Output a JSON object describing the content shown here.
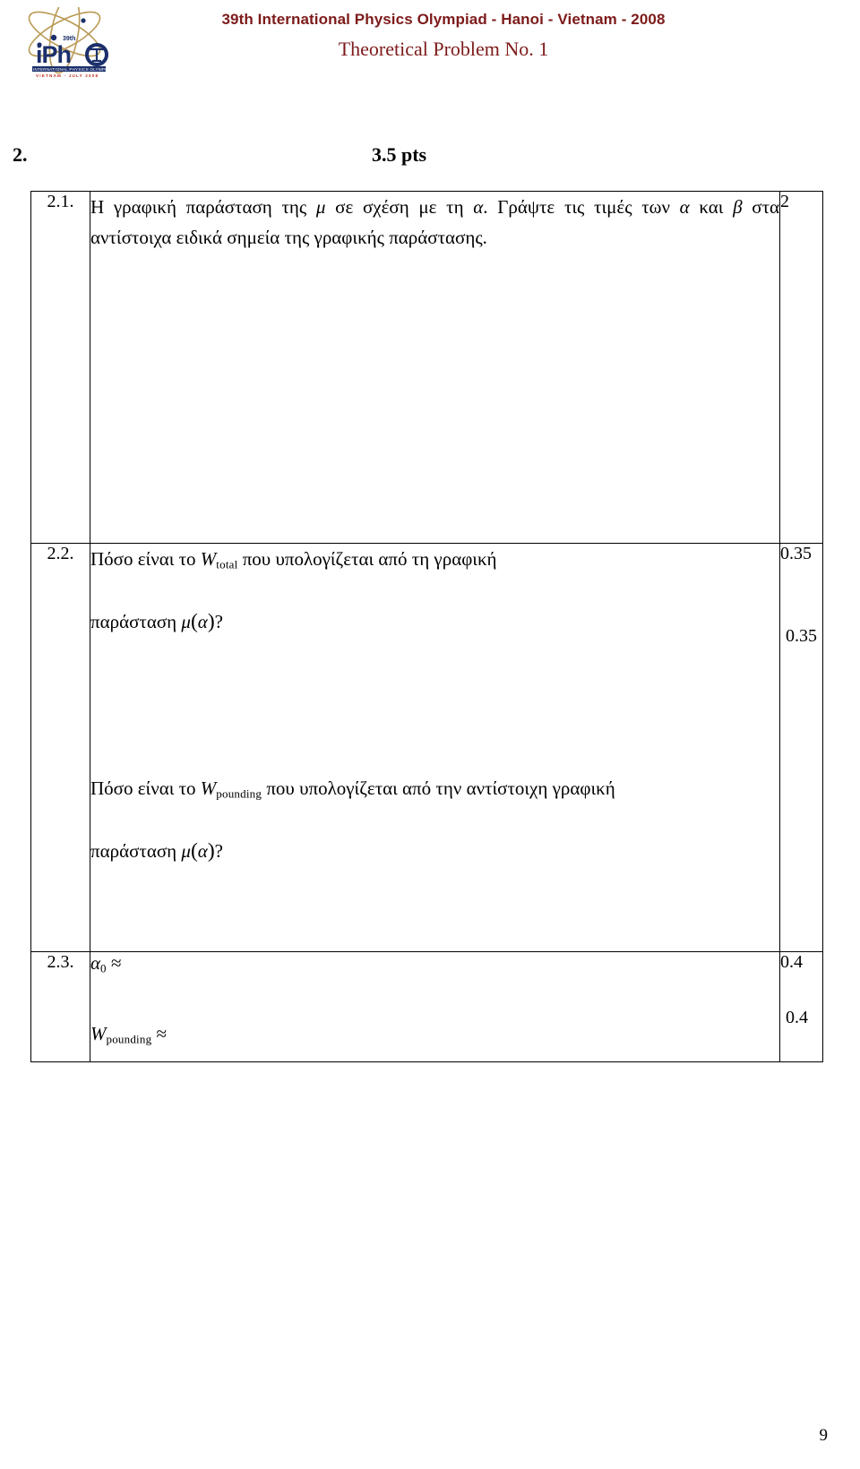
{
  "header": {
    "logo_alt": "ipho-logo",
    "logo_text_main": "iPhO",
    "logo_text_year": "39th",
    "logo_text_line1": "INTERNATIONAL PHYSICS OLYMPIAD",
    "logo_text_line2": "VIETNAM - JULY 2008",
    "line1": "39th International Physics Olympiad - Hanoi - Vietnam - 2008",
    "line2": "Theoretical Problem No. 1",
    "color": "#7d1a1a"
  },
  "section": {
    "number": "2.",
    "points": "3.5 pts"
  },
  "table": {
    "rows": [
      {
        "index": "2.1.",
        "paragraphs": [
          {
            "pre": "Η γραφική παράσταση της ",
            "sym1": "μ",
            "mid": " σε σχέση με τη ",
            "sym2": "α",
            "post": ". Γράψτε τις τιμές των "
          },
          {
            "sym1": "α",
            "mid": " και ",
            "sym2": "β",
            "post": " στα αντίστοιχα ειδικά σημεία της γραφικής παράστασης."
          }
        ],
        "scores": [
          "2"
        ]
      },
      {
        "index": "2.2.",
        "paragraphs": [
          {
            "pre": "Πόσο είναι το ",
            "w": "W",
            "wsub": "total",
            "post": " που υπολογίζεται από τη γραφική"
          },
          {
            "pre": "παράσταση ",
            "mu": "μ",
            "arg": "α",
            "post": "?"
          },
          {
            "pre": "Πόσο είναι το ",
            "w": "W",
            "wsub": "pounding",
            "post": " που υπολογίζεται από την αντίστοιχη γραφική"
          },
          {
            "pre": "παράσταση ",
            "mu": "μ",
            "arg": "α",
            "post": "?"
          }
        ],
        "scores": [
          "0.35",
          "0.35"
        ]
      },
      {
        "index": "2.3.",
        "answers": [
          {
            "sym": "α",
            "sub": "0",
            "rel": "≈"
          },
          {
            "sym": "W",
            "sub": "pounding",
            "rel": "≈"
          }
        ],
        "scores": [
          "0.4",
          "0.4"
        ]
      }
    ]
  },
  "footer": {
    "page_number": "9"
  }
}
